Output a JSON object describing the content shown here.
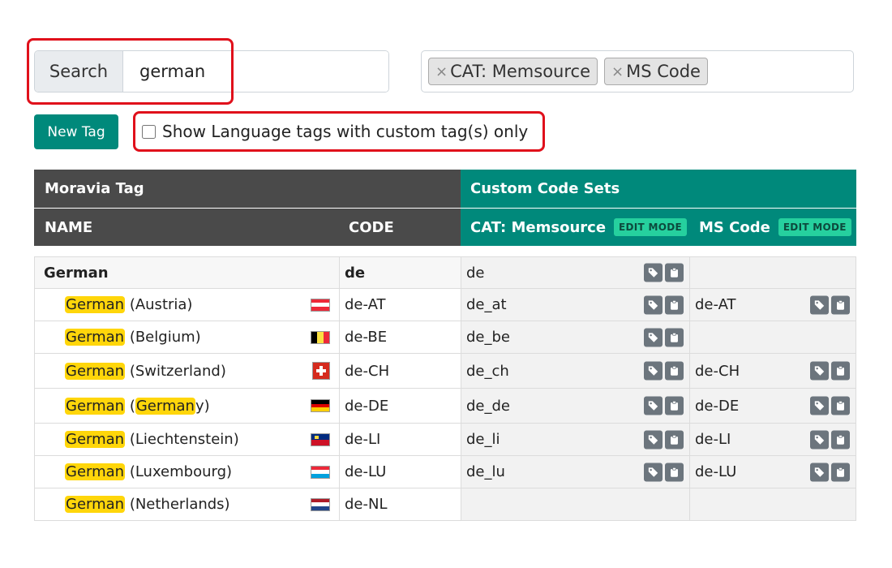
{
  "search": {
    "label": "Search",
    "value": "german"
  },
  "filter_tags": [
    "CAT: Memsource",
    "MS Code"
  ],
  "chip_remove_glyph": "×",
  "new_tag_label": "New Tag",
  "checkbox_label": "Show Language tags with custom tag(s) only",
  "checkbox_checked": false,
  "headers": {
    "moravia": "Moravia Tag",
    "custom": "Custom Code Sets",
    "name": "NAME",
    "code": "CODE",
    "cat": "CAT: Memsource",
    "ms": "MS Code",
    "edit_mode": "EDIT MODE"
  },
  "colors": {
    "teal": "#00897b",
    "dark_header": "#4a4a4a",
    "highlight": "#ffd60a",
    "annotation": "#e0101b",
    "edit_badge": "#26d09e"
  },
  "rows": [
    {
      "name": "German",
      "code": "de",
      "cat": "de",
      "ms": "",
      "root": true
    },
    {
      "name_hl": "German",
      "name_rest": " (Austria)",
      "flag": "austria",
      "code": "de-AT",
      "cat": "de_at",
      "ms": "de-AT"
    },
    {
      "name_hl": "German",
      "name_rest": " (Belgium)",
      "flag": "belgium",
      "code": "de-BE",
      "cat": "de_be",
      "ms": ""
    },
    {
      "name_hl": "German",
      "name_rest": " (Switzerland)",
      "flag": "switzerland",
      "code": "de-CH",
      "cat": "de_ch",
      "ms": "de-CH"
    },
    {
      "name_hl": "German",
      "name_pre": " (",
      "name_hl2": "German",
      "name_rest": "y)",
      "flag": "germany",
      "code": "de-DE",
      "cat": "de_de",
      "ms": "de-DE"
    },
    {
      "name_hl": "German",
      "name_rest": " (Liechtenstein)",
      "flag": "liechtenstein",
      "code": "de-LI",
      "cat": "de_li",
      "ms": "de-LI"
    },
    {
      "name_hl": "German",
      "name_rest": " (Luxembourg)",
      "flag": "luxembourg",
      "code": "de-LU",
      "cat": "de_lu",
      "ms": "de-LU"
    },
    {
      "name_hl": "German",
      "name_rest": " (Netherlands)",
      "flag": "netherlands",
      "code": "de-NL",
      "cat": "",
      "ms": ""
    }
  ],
  "icons": {
    "tag": "tag-icon",
    "clipboard": "clipboard-icon"
  }
}
